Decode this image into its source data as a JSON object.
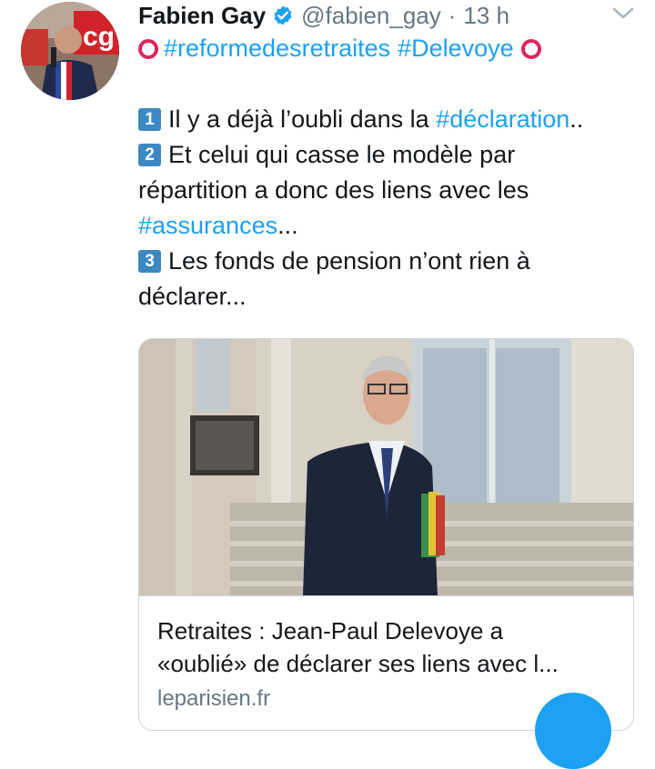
{
  "tweet": {
    "author_name": "Fabien Gay",
    "handle": "@fabien_gay",
    "separator": "·",
    "time": "13 h",
    "hashtag_1": "#reformedesretraites",
    "hashtag_2": "#Delevoye",
    "lines": {
      "l1_num": "1",
      "l1_text": "Il y a déjà l’oubli dans la ",
      "l1_link": "#déclaration",
      "l1_tail": "..",
      "l2_num": "2",
      "l2_text": "Et celui qui casse le modèle par",
      "l3_text": "répartition a donc des liens avec les",
      "l4_link": "#assurances",
      "l4_tail": "...",
      "l5_num": "3",
      "l5_text": "Les fonds de pension n’ont rien à",
      "l6_text": "déclarer..."
    }
  },
  "card": {
    "title_line_1": "Retraites : Jean-Paul Delevoye a",
    "title_line_2": "«oublié» de déclarer ses liens avec l...",
    "domain": "leparisien.fr"
  },
  "avatar_banner_text": "cg",
  "colors": {
    "link": "#1da1f2",
    "muted": "#657786",
    "circle_emoji": "#e0245e",
    "keycap": "#3b88c3",
    "verified": "#1da1f2"
  },
  "icons": [
    "verified-badge-icon",
    "chevron-down-icon",
    "hollow-red-circle-icon",
    "keycap-digit-icon"
  ]
}
